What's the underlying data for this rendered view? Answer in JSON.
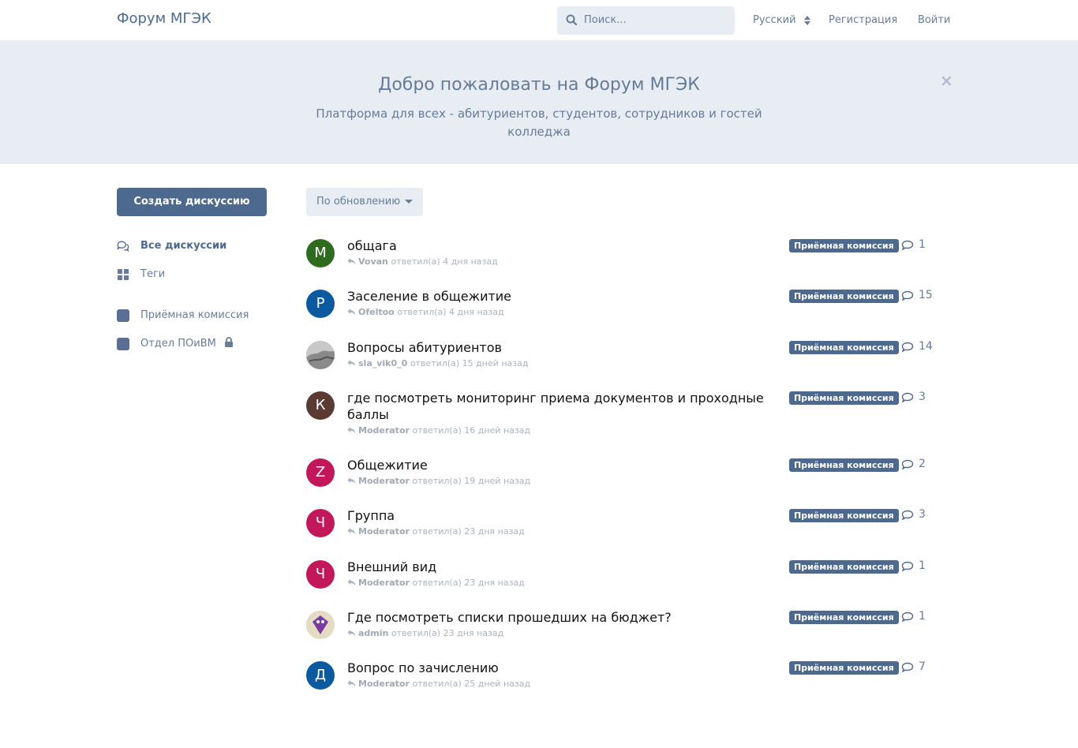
{
  "header": {
    "brand": "Форум МГЭК",
    "search_placeholder": "Поиск...",
    "language": "Русский",
    "register": "Регистрация",
    "login": "Войти"
  },
  "hero": {
    "title": "Добро пожаловать на Форум МГЭК",
    "subtitle": "Платформа для всех - абитуриентов, студентов, сотрудников и гостей колледжа",
    "close": "×"
  },
  "sidebar": {
    "new_discussion": "Создать дискуссию",
    "items": [
      {
        "label": "Все дискуссии"
      },
      {
        "label": "Теги"
      },
      {
        "label": "Приёмная комиссия"
      },
      {
        "label": "Отдел ПОиВМ"
      }
    ]
  },
  "sort": {
    "label": "По обновлению"
  },
  "colors": {
    "accent": "#4d698e",
    "hero_bg": "#e8ecf3"
  },
  "discussions": [
    {
      "title": "общага",
      "avatar_letter": "M",
      "avatar_color": "#2e6b1f",
      "user": "Vovan",
      "action": "ответил(а) 4 дня назад",
      "tag": "Приёмная комиссия",
      "replies": "1"
    },
    {
      "title": "Заселение в общежитие",
      "avatar_letter": "P",
      "avatar_color": "#0b5aa0",
      "user": "Ofeltoo",
      "action": "ответил(а) 4 дня назад",
      "tag": "Приёмная комиссия",
      "replies": "15"
    },
    {
      "title": "Вопросы абитуриентов",
      "avatar_letter": "",
      "avatar_color": "#9a9a9a",
      "user": "sla_vik0_0",
      "action": "ответил(а) 15 дней назад",
      "tag": "Приёмная комиссия",
      "replies": "14"
    },
    {
      "title": "где посмотреть мониторинг приема документов и проходные баллы",
      "avatar_letter": "К",
      "avatar_color": "#5a3a33",
      "user": "Moderator",
      "action": "ответил(а) 16 дней назад",
      "tag": "Приёмная комиссия",
      "replies": "3"
    },
    {
      "title": "Общежитие",
      "avatar_letter": "Z",
      "avatar_color": "#c2185b",
      "user": "Moderator",
      "action": "ответил(а) 19 дней назад",
      "tag": "Приёмная комиссия",
      "replies": "2"
    },
    {
      "title": "Группа",
      "avatar_letter": "Ч",
      "avatar_color": "#c2185b",
      "user": "Moderator",
      "action": "ответил(а) 23 дня назад",
      "tag": "Приёмная комиссия",
      "replies": "3"
    },
    {
      "title": "Внешний вид",
      "avatar_letter": "Ч",
      "avatar_color": "#c2185b",
      "user": "Moderator",
      "action": "ответил(а) 23 дня назад",
      "tag": "Приёмная комиссия",
      "replies": "1"
    },
    {
      "title": "Где посмотреть списки прошедших на бюджет?",
      "avatar_letter": "",
      "avatar_color": "#e3dcc3",
      "user": "admin",
      "action": "ответил(а) 23 дня назад",
      "tag": "Приёмная комиссия",
      "replies": "1"
    },
    {
      "title": "Вопрос по зачислению",
      "avatar_letter": "Д",
      "avatar_color": "#0b5aa0",
      "user": "Moderator",
      "action": "ответил(а) 25 дней назад",
      "tag": "Приёмная комиссия",
      "replies": "7"
    }
  ]
}
